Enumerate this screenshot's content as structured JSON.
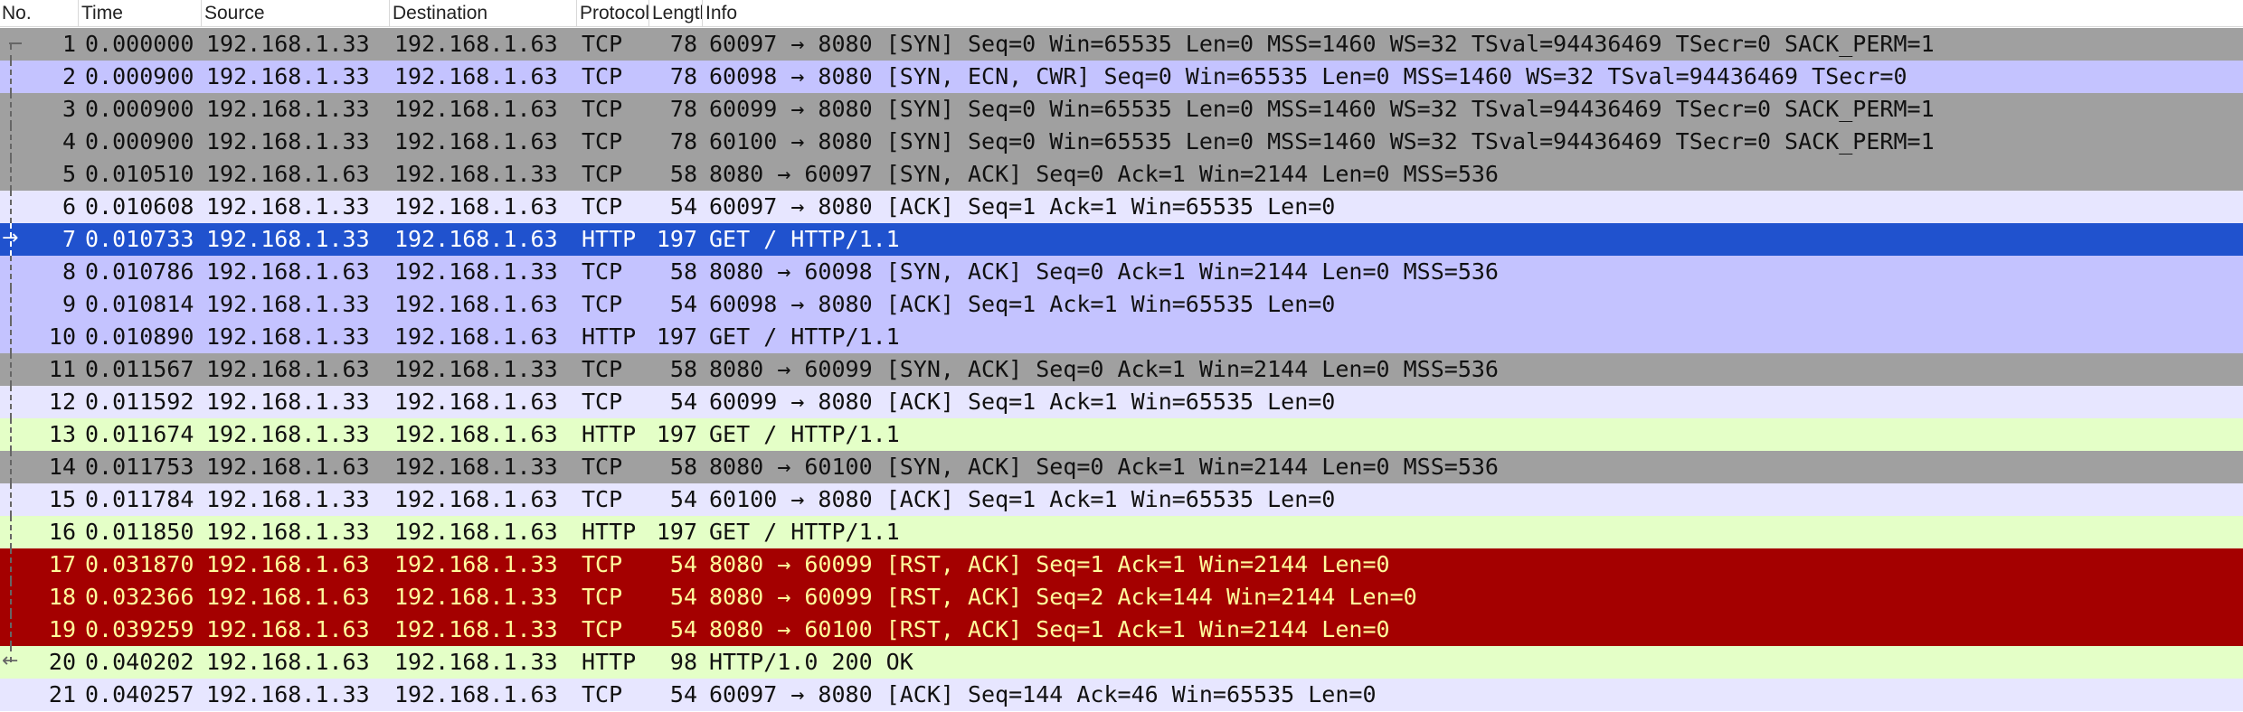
{
  "window": {
    "columns": [
      {
        "key": "no",
        "label": "No."
      },
      {
        "key": "time",
        "label": "Time"
      },
      {
        "key": "source",
        "label": "Source"
      },
      {
        "key": "destination",
        "label": "Destination"
      },
      {
        "key": "protocol",
        "label": "Protocol"
      },
      {
        "key": "length",
        "label": "Length"
      },
      {
        "key": "info",
        "label": "Info"
      }
    ]
  },
  "colors": {
    "syn_gray": "#a0a0a0",
    "tcp_lavender": "#e7e6ff",
    "stream_blue": "#c4c3ff",
    "http_green": "#e4ffc7",
    "rst_red": "#a40000",
    "rst_text": "#fffc9c",
    "selected": "#2052ce",
    "text": "#111111"
  },
  "icons": {
    "selected_marker": "arrow-right-icon",
    "response_marker": "arrow-left-icon",
    "first_marker": "bracket-corner-icon"
  },
  "packets": [
    {
      "no": "1",
      "time": "0.000000",
      "src": "192.168.1.33",
      "dst": "192.168.1.63",
      "proto": "TCP",
      "len": "78",
      "info": "60097 → 8080 [SYN] Seq=0 Win=65535 Len=0 MSS=1460 WS=32 TSval=94436469 TSecr=0 SACK_PERM=1",
      "style": "syn_gray",
      "marker": "first"
    },
    {
      "no": "2",
      "time": "0.000900",
      "src": "192.168.1.33",
      "dst": "192.168.1.63",
      "proto": "TCP",
      "len": "78",
      "info": "60098 → 8080 [SYN, ECN, CWR] Seq=0 Win=65535 Len=0 MSS=1460 WS=32 TSval=94436469 TSecr=0",
      "style": "stream_blue"
    },
    {
      "no": "3",
      "time": "0.000900",
      "src": "192.168.1.33",
      "dst": "192.168.1.63",
      "proto": "TCP",
      "len": "78",
      "info": "60099 → 8080 [SYN] Seq=0 Win=65535 Len=0 MSS=1460 WS=32 TSval=94436469 TSecr=0 SACK_PERM=1",
      "style": "syn_gray"
    },
    {
      "no": "4",
      "time": "0.000900",
      "src": "192.168.1.33",
      "dst": "192.168.1.63",
      "proto": "TCP",
      "len": "78",
      "info": "60100 → 8080 [SYN] Seq=0 Win=65535 Len=0 MSS=1460 WS=32 TSval=94436469 TSecr=0 SACK_PERM=1",
      "style": "syn_gray"
    },
    {
      "no": "5",
      "time": "0.010510",
      "src": "192.168.1.63",
      "dst": "192.168.1.33",
      "proto": "TCP",
      "len": "58",
      "info": "8080 → 60097 [SYN, ACK] Seq=0 Ack=1 Win=2144 Len=0 MSS=536",
      "style": "syn_gray"
    },
    {
      "no": "6",
      "time": "0.010608",
      "src": "192.168.1.33",
      "dst": "192.168.1.63",
      "proto": "TCP",
      "len": "54",
      "info": "60097 → 8080 [ACK] Seq=1 Ack=1 Win=65535 Len=0",
      "style": "tcp_lavender"
    },
    {
      "no": "7",
      "time": "0.010733",
      "src": "192.168.1.33",
      "dst": "192.168.1.63",
      "proto": "HTTP",
      "len": "197",
      "info": "GET / HTTP/1.1",
      "style": "selected",
      "marker": "selected"
    },
    {
      "no": "8",
      "time": "0.010786",
      "src": "192.168.1.63",
      "dst": "192.168.1.33",
      "proto": "TCP",
      "len": "58",
      "info": "8080 → 60098 [SYN, ACK] Seq=0 Ack=1 Win=2144 Len=0 MSS=536",
      "style": "stream_blue"
    },
    {
      "no": "9",
      "time": "0.010814",
      "src": "192.168.1.33",
      "dst": "192.168.1.63",
      "proto": "TCP",
      "len": "54",
      "info": "60098 → 8080 [ACK] Seq=1 Ack=1 Win=65535 Len=0",
      "style": "stream_blue"
    },
    {
      "no": "10",
      "time": "0.010890",
      "src": "192.168.1.33",
      "dst": "192.168.1.63",
      "proto": "HTTP",
      "len": "197",
      "info": "GET / HTTP/1.1",
      "style": "stream_blue"
    },
    {
      "no": "11",
      "time": "0.011567",
      "src": "192.168.1.63",
      "dst": "192.168.1.33",
      "proto": "TCP",
      "len": "58",
      "info": "8080 → 60099 [SYN, ACK] Seq=0 Ack=1 Win=2144 Len=0 MSS=536",
      "style": "syn_gray"
    },
    {
      "no": "12",
      "time": "0.011592",
      "src": "192.168.1.33",
      "dst": "192.168.1.63",
      "proto": "TCP",
      "len": "54",
      "info": "60099 → 8080 [ACK] Seq=1 Ack=1 Win=65535 Len=0",
      "style": "tcp_lavender"
    },
    {
      "no": "13",
      "time": "0.011674",
      "src": "192.168.1.33",
      "dst": "192.168.1.63",
      "proto": "HTTP",
      "len": "197",
      "info": "GET / HTTP/1.1",
      "style": "http_green"
    },
    {
      "no": "14",
      "time": "0.011753",
      "src": "192.168.1.63",
      "dst": "192.168.1.33",
      "proto": "TCP",
      "len": "58",
      "info": "8080 → 60100 [SYN, ACK] Seq=0 Ack=1 Win=2144 Len=0 MSS=536",
      "style": "syn_gray"
    },
    {
      "no": "15",
      "time": "0.011784",
      "src": "192.168.1.33",
      "dst": "192.168.1.63",
      "proto": "TCP",
      "len": "54",
      "info": "60100 → 8080 [ACK] Seq=1 Ack=1 Win=65535 Len=0",
      "style": "tcp_lavender"
    },
    {
      "no": "16",
      "time": "0.011850",
      "src": "192.168.1.33",
      "dst": "192.168.1.63",
      "proto": "HTTP",
      "len": "197",
      "info": "GET / HTTP/1.1",
      "style": "http_green"
    },
    {
      "no": "17",
      "time": "0.031870",
      "src": "192.168.1.63",
      "dst": "192.168.1.33",
      "proto": "TCP",
      "len": "54",
      "info": "8080 → 60099 [RST, ACK] Seq=1 Ack=1 Win=2144 Len=0",
      "style": "rst_red"
    },
    {
      "no": "18",
      "time": "0.032366",
      "src": "192.168.1.63",
      "dst": "192.168.1.33",
      "proto": "TCP",
      "len": "54",
      "info": "8080 → 60099 [RST, ACK] Seq=2 Ack=144 Win=2144 Len=0",
      "style": "rst_red"
    },
    {
      "no": "19",
      "time": "0.039259",
      "src": "192.168.1.63",
      "dst": "192.168.1.33",
      "proto": "TCP",
      "len": "54",
      "info": "8080 → 60100 [RST, ACK] Seq=1 Ack=1 Win=2144 Len=0",
      "style": "rst_red"
    },
    {
      "no": "20",
      "time": "0.040202",
      "src": "192.168.1.63",
      "dst": "192.168.1.33",
      "proto": "HTTP",
      "len": "98",
      "info": "HTTP/1.0 200 OK",
      "style": "http_green",
      "marker": "response"
    },
    {
      "no": "21",
      "time": "0.040257",
      "src": "192.168.1.33",
      "dst": "192.168.1.63",
      "proto": "TCP",
      "len": "54",
      "info": "60097 → 8080 [ACK] Seq=144 Ack=46 Win=65535 Len=0",
      "style": "tcp_lavender"
    }
  ]
}
